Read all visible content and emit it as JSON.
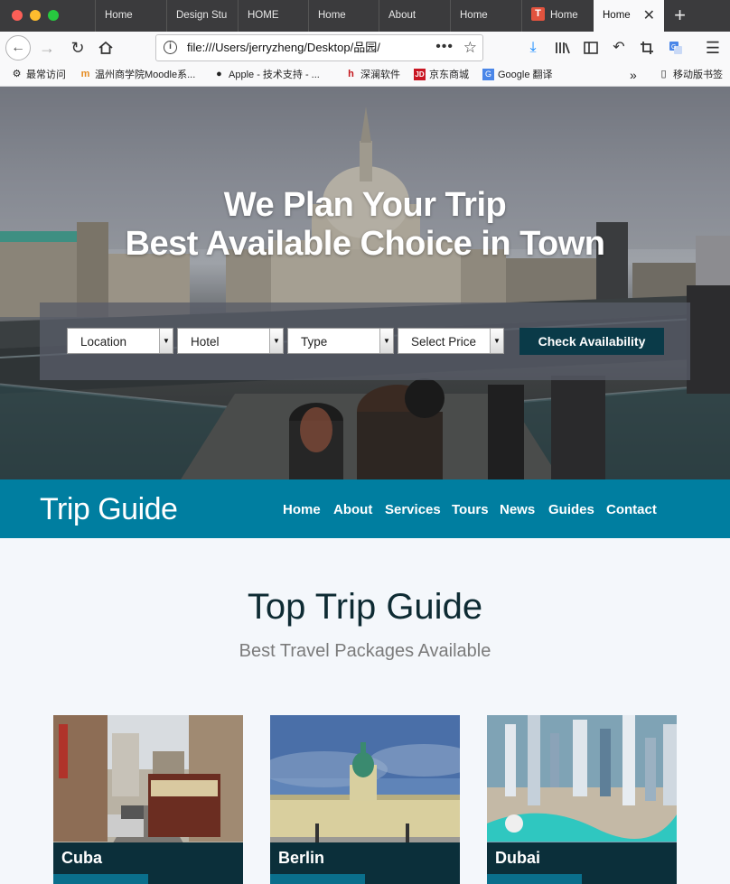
{
  "browser": {
    "tabs": [
      {
        "label": "Home"
      },
      {
        "label": "Design Stu"
      },
      {
        "label": "HOME"
      },
      {
        "label": "Home"
      },
      {
        "label": "About"
      },
      {
        "label": "Home"
      },
      {
        "label": "Home"
      },
      {
        "label": "Home"
      }
    ],
    "tab_favicon_letter": "T",
    "url": "file:///Users/jerryzheng/Desktop/品园/",
    "bookmarks": [
      {
        "label": "最常访问",
        "icon": "gear-icon"
      },
      {
        "label": "温州商学院Moodle系...",
        "icon": "moodle-icon"
      },
      {
        "label": "Apple - 技术支持 - ...",
        "icon": "apple-icon"
      },
      {
        "label": "深澜软件",
        "icon": "srun-icon"
      },
      {
        "label": "京东商城",
        "icon": "jd-icon"
      },
      {
        "label": "Google 翻译",
        "icon": "google-translate-icon"
      },
      {
        "label": "移动版书签",
        "icon": "mobile-icon"
      }
    ]
  },
  "hero": {
    "title_line1": "We Plan Your Trip",
    "title_line2": "Best Available Choice in Town",
    "filters": [
      {
        "label": "Location"
      },
      {
        "label": "Hotel"
      },
      {
        "label": "Type"
      },
      {
        "label": "Select Price"
      }
    ],
    "check_button": "Check Availability"
  },
  "header": {
    "logo": "Trip Guide",
    "menu": [
      "Home",
      "About",
      "Services",
      "Tours",
      "News",
      "Guides",
      "Contact"
    ]
  },
  "section": {
    "title": "Top Trip Guide",
    "subtitle": "Best Travel Packages Available"
  },
  "cards": [
    {
      "caption": "Cuba"
    },
    {
      "caption": "Berlin"
    },
    {
      "caption": "Dubai"
    }
  ],
  "colors": {
    "header_bg": "#007ea0",
    "button_bg": "#0a3a48",
    "caption_bg": "#0b2f3a",
    "page_bg": "#f4f7fb"
  }
}
